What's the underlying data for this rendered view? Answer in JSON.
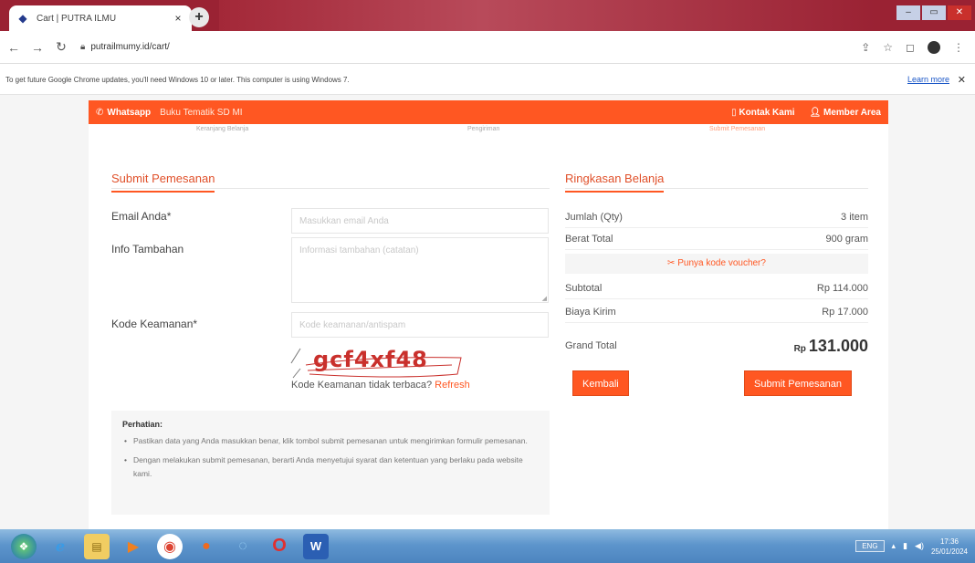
{
  "browser": {
    "tab_title": "Cart | PUTRA ILMU",
    "tab_close": "×",
    "new_tab": "+",
    "url": "putrailmumy.id/cart/",
    "infobar_text": "To get future Google Chrome updates, you'll need Windows 10 or later. This computer is using Windows 7.",
    "learn_more": "Learn more",
    "infobar_close": "✕"
  },
  "site": {
    "whatsapp_label": "Whatsapp",
    "category_label": "Buku Tematik SD MI",
    "contact_label": "Kontak Kami",
    "member_label": "Member Area",
    "steps": [
      "Keranjang Belanja",
      "Pengiriman",
      "Submit Pemesanan"
    ]
  },
  "form": {
    "title": "Submit Pemesanan",
    "email_label": "Email Anda*",
    "email_placeholder": "Masukkan email Anda",
    "info_label": "Info Tambahan",
    "info_placeholder": "Informasi tambahan (catatan)",
    "security_label": "Kode Keamanan*",
    "security_placeholder": "Kode keamanan/antispam",
    "captcha_text": "gcf4xf48",
    "captcha_note": "Kode Keamanan tidak terbaca?",
    "refresh_label": "Refresh"
  },
  "notice": {
    "heading": "Perhatian:",
    "items": [
      "Pastikan data yang Anda masukkan benar, klik tombol submit pemesanan untuk mengirimkan formulir pemesanan.",
      "Dengan melakukan submit pemesanan, berarti Anda menyetujui syarat dan ketentuan yang berlaku pada website kami."
    ]
  },
  "summary": {
    "title": "Ringkasan Belanja",
    "qty_label": "Jumlah (Qty)",
    "qty_value": "3 item",
    "weight_label": "Berat Total",
    "weight_value": "900 gram",
    "voucher_label": "Punya kode voucher?",
    "subtotal_label": "Subtotal",
    "subtotal_value": "Rp 114.000",
    "shipping_label": "Biaya Kirim",
    "shipping_value": "Rp 17.000",
    "grand_label": "Grand Total",
    "grand_currency": "Rp",
    "grand_value": "131.000",
    "back_button": "Kembali",
    "submit_button": "Submit Pemesanan"
  },
  "taskbar": {
    "language": "ENG",
    "time": "17:36",
    "date": "25/01/2024"
  },
  "colors": {
    "accent": "#ff5722",
    "chrome_frame": "#9a2233"
  }
}
